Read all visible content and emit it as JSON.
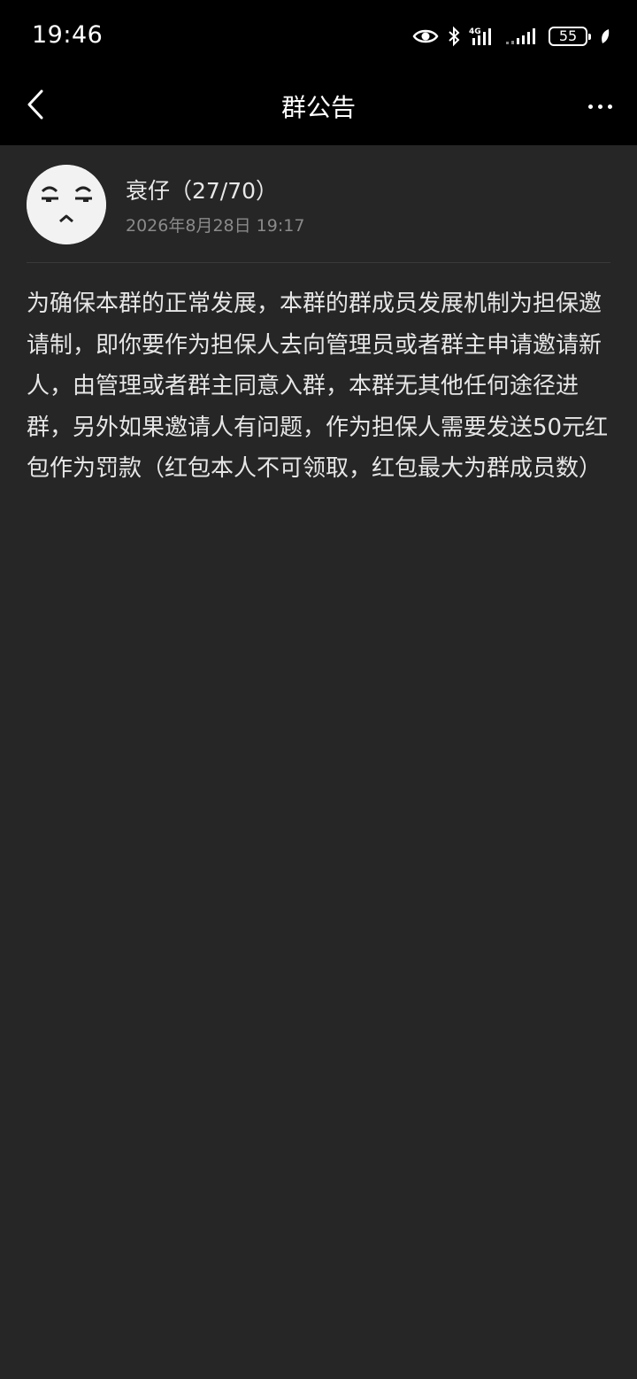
{
  "status_bar": {
    "time": "19:46",
    "network_label": "4G",
    "battery_level": "55",
    "icons": [
      "eye-icon",
      "bluetooth-icon",
      "signal-4g-icon",
      "signal-icon",
      "battery-icon",
      "leaf-icon"
    ]
  },
  "header": {
    "title": "群公告",
    "back_icon": "chevron-left-icon",
    "more_icon": "more-dots-icon"
  },
  "announcement": {
    "author_name": "衰仔（27/70）",
    "timestamp": "2026年8月28日 19:17",
    "body": "为确保本群的正常发展，本群的群成员发展机制为担保邀请制，即你要作为担保人去向管理员或者群主申请邀请新人，由管理或者群主同意入群，本群无其他任何途径进群，另外如果邀请人有问题，作为担保人需要发送50元红包作为罚款（红包本人不可领取，红包最大为群成员数）"
  },
  "colors": {
    "background": "#262626",
    "bar_background": "#000000",
    "text_primary": "#e6e6e6",
    "text_secondary": "#8a8a8a"
  }
}
